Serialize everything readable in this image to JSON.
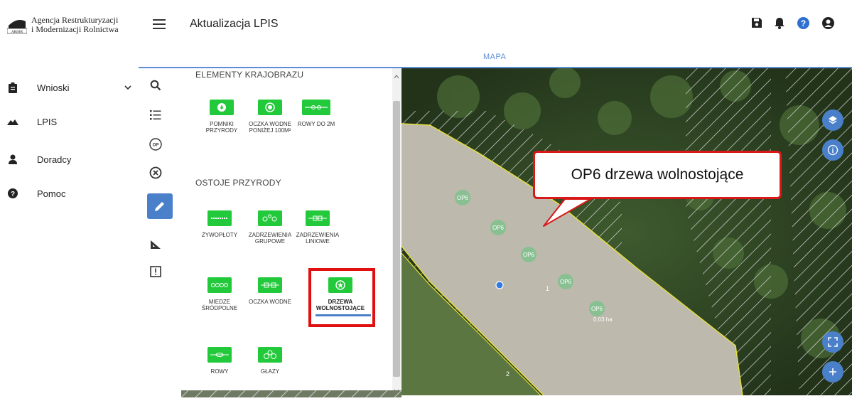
{
  "org": {
    "line1": "Agencja Restrukturyzacji",
    "line2": "i Modernizacji Rolnictwa",
    "logo_text": "ARiMR"
  },
  "nav": [
    {
      "label": "Wnioski",
      "icon": "clipboard-icon",
      "has_chevron": true
    },
    {
      "label": "LPIS",
      "icon": "mountain-icon"
    },
    {
      "label": "Doradcy",
      "icon": "person-icon"
    },
    {
      "label": "Pomoc",
      "icon": "help-icon"
    }
  ],
  "header": {
    "title": "Aktualizacja LPIS",
    "icons": [
      "save-icon",
      "bell-icon",
      "help-icon",
      "account-icon"
    ]
  },
  "tabs": [
    {
      "label": "MAPA",
      "active": true
    }
  ],
  "tools": [
    "search-icon",
    "list-icon",
    "op-icon",
    "close-circle-icon",
    "edit-icon",
    "measure-icon",
    "warning-box-icon"
  ],
  "tool_op_text": "OP",
  "panel": {
    "section1": {
      "title": "ELEMENTY KRAJOBRAZU",
      "items": [
        {
          "label": "POMNIKI PRZYRODY"
        },
        {
          "label": "OCZKA WODNE PONIŻEJ 100M²"
        },
        {
          "label": "ROWY DO 2M"
        }
      ]
    },
    "section2": {
      "title": "OSTOJE PRZYRODY",
      "items": [
        {
          "label": "ŻYWOPŁOTY"
        },
        {
          "label": "ZADRZEWIENIA GRUPOWE"
        },
        {
          "label": "ZADRZEWIENIA LINIOWE"
        },
        {
          "label": "MIEDZE ŚRÓDPOLNE"
        },
        {
          "label": "OCZKA WODNE"
        },
        {
          "label": "DRZEWA WOLNOSTOJĄCE",
          "selected": true
        },
        {
          "label": "ROWY"
        },
        {
          "label": "GŁAZY"
        }
      ]
    }
  },
  "map": {
    "markers": [
      "OP6",
      "OP6",
      "OP6",
      "OP6",
      "OP6"
    ],
    "parcel_labels": [
      "1",
      "2"
    ],
    "area_label": "0.03 ha",
    "buttons": [
      "layers-icon",
      "info-icon",
      "fullscreen-icon",
      "zoom-in-icon"
    ]
  },
  "callout": {
    "text": "OP6 drzewa wolnostojące"
  },
  "colors": {
    "accent": "#4a80c9",
    "tile_green": "#22c93a",
    "highlight_red": "#e01010",
    "parcel_line": "#e8e23a"
  }
}
